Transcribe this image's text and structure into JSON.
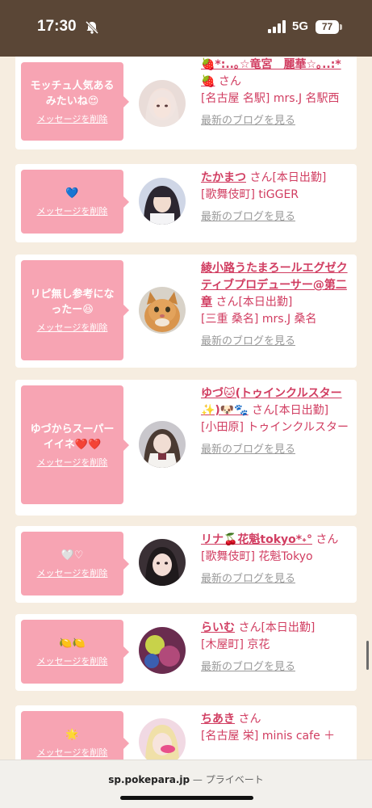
{
  "status_bar": {
    "time": "17:30",
    "network": "5G",
    "battery": "77"
  },
  "cards": [
    {
      "message": "モッチュ人気あるみたいね😍",
      "delete": "メッセージを削除",
      "name": "🍓*:..｡☆竜宮　麗華☆｡..:*🍓",
      "san": "さん",
      "detail": "[名古屋 名駅] mrs.J 名駅西",
      "blog": "最新のブログを見る"
    },
    {
      "message": "💙",
      "delete": "メッセージを削除",
      "name": "たかまつ",
      "san": "さん",
      "badge": "[本日出勤]",
      "detail": "[歌舞伎町] tiGGER",
      "blog": "最新のブログを見る"
    },
    {
      "message": "リピ無し参考になったー😆",
      "delete": "メッセージを削除",
      "name": "綾小路うたまろールエグゼクティブプロデューサー@第二章",
      "san": "さん",
      "badge": "[本日出勤]",
      "detail": "[三重 桑名] mrs.J 桑名",
      "blog": "最新のブログを見る"
    },
    {
      "message": "ゆづからスーパーイイネ❤️❤️",
      "delete": "メッセージを削除",
      "name": "ゆづ🐱(トゥインクルスター✨)🐶🐾",
      "san": "さん",
      "badge": "[本日出勤]",
      "detail": "[小田原] トゥインクルスター",
      "blog": "最新のブログを見る"
    },
    {
      "message": "🤍♡",
      "delete": "メッセージを削除",
      "name": "リナ🍒花魁tokyo*˖°",
      "san": "さん",
      "detail": "[歌舞伎町] 花魁Tokyo",
      "blog": "最新のブログを見る"
    },
    {
      "message": "🍋🍋",
      "delete": "メッセージを削除",
      "name": "らいむ",
      "san": "さん",
      "badge": "[本日出勤]",
      "detail": "[木屋町] 京花",
      "blog": "最新のブログを見る"
    },
    {
      "message": "🌟",
      "delete": "メッセージを削除",
      "name": "ちあき",
      "san": "さん",
      "detail": "[名古屋 栄] minis cafe ＋",
      "blog": ""
    }
  ],
  "url_bar": {
    "host": "sp.pokepara.jp",
    "separator": " — ",
    "mode": "プライベート"
  },
  "colors": {
    "accent": "#d13d61",
    "bubble": "#f7a4b3",
    "statusbar": "#5a4636",
    "background": "#f6ede0"
  }
}
